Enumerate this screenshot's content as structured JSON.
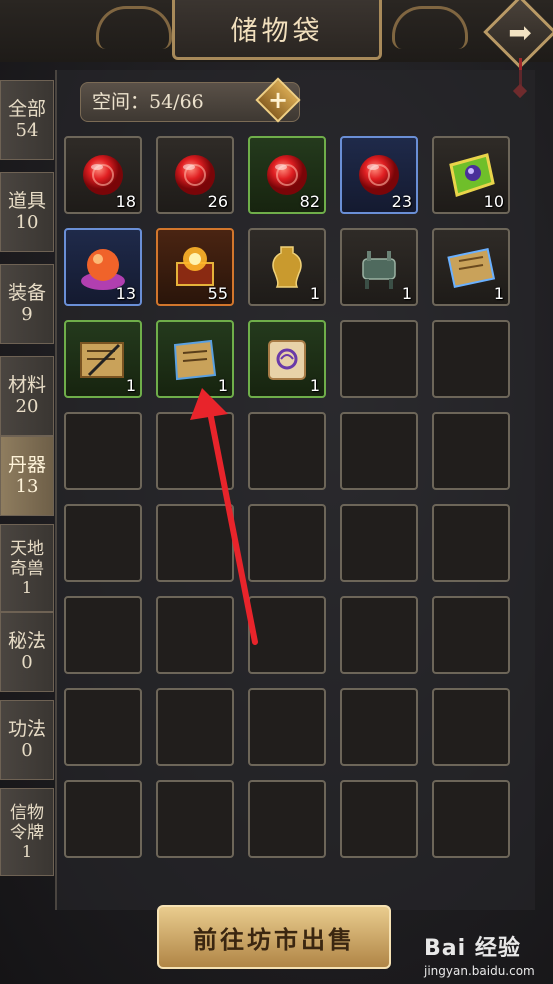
{
  "header": {
    "title": "储物袋",
    "next_icon": "right-arrow-icon"
  },
  "space": {
    "label": "空间：54/66",
    "add_icon": "plus-icon"
  },
  "sidebar": {
    "tabs": [
      {
        "label": "全部",
        "count": "54",
        "active": false
      },
      {
        "label": "道具",
        "count": "10",
        "active": false
      },
      {
        "label": "装备",
        "count": "9",
        "active": false
      },
      {
        "label": "材料",
        "count": "20",
        "active": false
      },
      {
        "label": "丹器",
        "count": "13",
        "active": true
      },
      {
        "label": "天地奇兽",
        "count": "1",
        "active": false
      },
      {
        "label": "秘法",
        "count": "0",
        "active": false
      },
      {
        "label": "功法",
        "count": "0",
        "active": false
      },
      {
        "label": "信物令牌",
        "count": "1",
        "active": false
      }
    ]
  },
  "inventory": {
    "items": [
      {
        "name": "red-orb-icon",
        "quality": "white",
        "count": "18"
      },
      {
        "name": "red-orb-icon",
        "quality": "white",
        "count": "26"
      },
      {
        "name": "red-orb-icon",
        "quality": "green",
        "count": "82"
      },
      {
        "name": "red-orb-icon",
        "quality": "blue",
        "count": "23"
      },
      {
        "name": "purple-gem-token-icon",
        "quality": "white",
        "count": "10"
      },
      {
        "name": "crystal-ball-cushion-icon",
        "quality": "blue",
        "count": "13"
      },
      {
        "name": "glowing-chest-icon",
        "quality": "orange",
        "count": "55"
      },
      {
        "name": "golden-vase-icon",
        "quality": "white",
        "count": "1"
      },
      {
        "name": "bronze-cauldron-icon",
        "quality": "white",
        "count": "1"
      },
      {
        "name": "scroll-blue-icon",
        "quality": "white",
        "count": "1"
      },
      {
        "name": "scroll-brush-icon",
        "quality": "green",
        "count": "1"
      },
      {
        "name": "torn-scroll-icon",
        "quality": "green",
        "count": "1"
      },
      {
        "name": "purple-scroll-icon",
        "quality": "green",
        "count": "1"
      }
    ],
    "empty_slots": 27
  },
  "footer": {
    "sell_label": "前往坊市出售"
  },
  "watermark": {
    "brand": "Bai 经验",
    "url": "jingyan.baidu.com"
  },
  "colors": {
    "accent": "#d8b06a",
    "active_tab": "#8f7d5f",
    "annotation_arrow": "#e8242b"
  }
}
